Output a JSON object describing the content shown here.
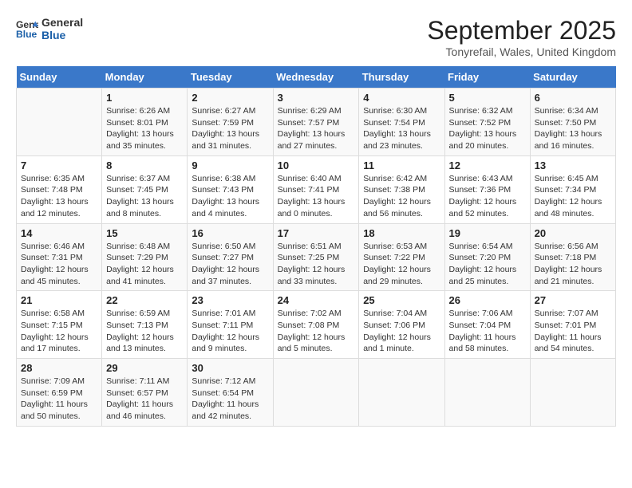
{
  "header": {
    "logo_line1": "General",
    "logo_line2": "Blue",
    "month": "September 2025",
    "location": "Tonyrefail, Wales, United Kingdom"
  },
  "weekdays": [
    "Sunday",
    "Monday",
    "Tuesday",
    "Wednesday",
    "Thursday",
    "Friday",
    "Saturday"
  ],
  "weeks": [
    [
      {
        "day": "",
        "sunrise": "",
        "sunset": "",
        "daylight": ""
      },
      {
        "day": "1",
        "sunrise": "Sunrise: 6:26 AM",
        "sunset": "Sunset: 8:01 PM",
        "daylight": "Daylight: 13 hours and 35 minutes."
      },
      {
        "day": "2",
        "sunrise": "Sunrise: 6:27 AM",
        "sunset": "Sunset: 7:59 PM",
        "daylight": "Daylight: 13 hours and 31 minutes."
      },
      {
        "day": "3",
        "sunrise": "Sunrise: 6:29 AM",
        "sunset": "Sunset: 7:57 PM",
        "daylight": "Daylight: 13 hours and 27 minutes."
      },
      {
        "day": "4",
        "sunrise": "Sunrise: 6:30 AM",
        "sunset": "Sunset: 7:54 PM",
        "daylight": "Daylight: 13 hours and 23 minutes."
      },
      {
        "day": "5",
        "sunrise": "Sunrise: 6:32 AM",
        "sunset": "Sunset: 7:52 PM",
        "daylight": "Daylight: 13 hours and 20 minutes."
      },
      {
        "day": "6",
        "sunrise": "Sunrise: 6:34 AM",
        "sunset": "Sunset: 7:50 PM",
        "daylight": "Daylight: 13 hours and 16 minutes."
      }
    ],
    [
      {
        "day": "7",
        "sunrise": "Sunrise: 6:35 AM",
        "sunset": "Sunset: 7:48 PM",
        "daylight": "Daylight: 13 hours and 12 minutes."
      },
      {
        "day": "8",
        "sunrise": "Sunrise: 6:37 AM",
        "sunset": "Sunset: 7:45 PM",
        "daylight": "Daylight: 13 hours and 8 minutes."
      },
      {
        "day": "9",
        "sunrise": "Sunrise: 6:38 AM",
        "sunset": "Sunset: 7:43 PM",
        "daylight": "Daylight: 13 hours and 4 minutes."
      },
      {
        "day": "10",
        "sunrise": "Sunrise: 6:40 AM",
        "sunset": "Sunset: 7:41 PM",
        "daylight": "Daylight: 13 hours and 0 minutes."
      },
      {
        "day": "11",
        "sunrise": "Sunrise: 6:42 AM",
        "sunset": "Sunset: 7:38 PM",
        "daylight": "Daylight: 12 hours and 56 minutes."
      },
      {
        "day": "12",
        "sunrise": "Sunrise: 6:43 AM",
        "sunset": "Sunset: 7:36 PM",
        "daylight": "Daylight: 12 hours and 52 minutes."
      },
      {
        "day": "13",
        "sunrise": "Sunrise: 6:45 AM",
        "sunset": "Sunset: 7:34 PM",
        "daylight": "Daylight: 12 hours and 48 minutes."
      }
    ],
    [
      {
        "day": "14",
        "sunrise": "Sunrise: 6:46 AM",
        "sunset": "Sunset: 7:31 PM",
        "daylight": "Daylight: 12 hours and 45 minutes."
      },
      {
        "day": "15",
        "sunrise": "Sunrise: 6:48 AM",
        "sunset": "Sunset: 7:29 PM",
        "daylight": "Daylight: 12 hours and 41 minutes."
      },
      {
        "day": "16",
        "sunrise": "Sunrise: 6:50 AM",
        "sunset": "Sunset: 7:27 PM",
        "daylight": "Daylight: 12 hours and 37 minutes."
      },
      {
        "day": "17",
        "sunrise": "Sunrise: 6:51 AM",
        "sunset": "Sunset: 7:25 PM",
        "daylight": "Daylight: 12 hours and 33 minutes."
      },
      {
        "day": "18",
        "sunrise": "Sunrise: 6:53 AM",
        "sunset": "Sunset: 7:22 PM",
        "daylight": "Daylight: 12 hours and 29 minutes."
      },
      {
        "day": "19",
        "sunrise": "Sunrise: 6:54 AM",
        "sunset": "Sunset: 7:20 PM",
        "daylight": "Daylight: 12 hours and 25 minutes."
      },
      {
        "day": "20",
        "sunrise": "Sunrise: 6:56 AM",
        "sunset": "Sunset: 7:18 PM",
        "daylight": "Daylight: 12 hours and 21 minutes."
      }
    ],
    [
      {
        "day": "21",
        "sunrise": "Sunrise: 6:58 AM",
        "sunset": "Sunset: 7:15 PM",
        "daylight": "Daylight: 12 hours and 17 minutes."
      },
      {
        "day": "22",
        "sunrise": "Sunrise: 6:59 AM",
        "sunset": "Sunset: 7:13 PM",
        "daylight": "Daylight: 12 hours and 13 minutes."
      },
      {
        "day": "23",
        "sunrise": "Sunrise: 7:01 AM",
        "sunset": "Sunset: 7:11 PM",
        "daylight": "Daylight: 12 hours and 9 minutes."
      },
      {
        "day": "24",
        "sunrise": "Sunrise: 7:02 AM",
        "sunset": "Sunset: 7:08 PM",
        "daylight": "Daylight: 12 hours and 5 minutes."
      },
      {
        "day": "25",
        "sunrise": "Sunrise: 7:04 AM",
        "sunset": "Sunset: 7:06 PM",
        "daylight": "Daylight: 12 hours and 1 minute."
      },
      {
        "day": "26",
        "sunrise": "Sunrise: 7:06 AM",
        "sunset": "Sunset: 7:04 PM",
        "daylight": "Daylight: 11 hours and 58 minutes."
      },
      {
        "day": "27",
        "sunrise": "Sunrise: 7:07 AM",
        "sunset": "Sunset: 7:01 PM",
        "daylight": "Daylight: 11 hours and 54 minutes."
      }
    ],
    [
      {
        "day": "28",
        "sunrise": "Sunrise: 7:09 AM",
        "sunset": "Sunset: 6:59 PM",
        "daylight": "Daylight: 11 hours and 50 minutes."
      },
      {
        "day": "29",
        "sunrise": "Sunrise: 7:11 AM",
        "sunset": "Sunset: 6:57 PM",
        "daylight": "Daylight: 11 hours and 46 minutes."
      },
      {
        "day": "30",
        "sunrise": "Sunrise: 7:12 AM",
        "sunset": "Sunset: 6:54 PM",
        "daylight": "Daylight: 11 hours and 42 minutes."
      },
      {
        "day": "",
        "sunrise": "",
        "sunset": "",
        "daylight": ""
      },
      {
        "day": "",
        "sunrise": "",
        "sunset": "",
        "daylight": ""
      },
      {
        "day": "",
        "sunrise": "",
        "sunset": "",
        "daylight": ""
      },
      {
        "day": "",
        "sunrise": "",
        "sunset": "",
        "daylight": ""
      }
    ]
  ]
}
